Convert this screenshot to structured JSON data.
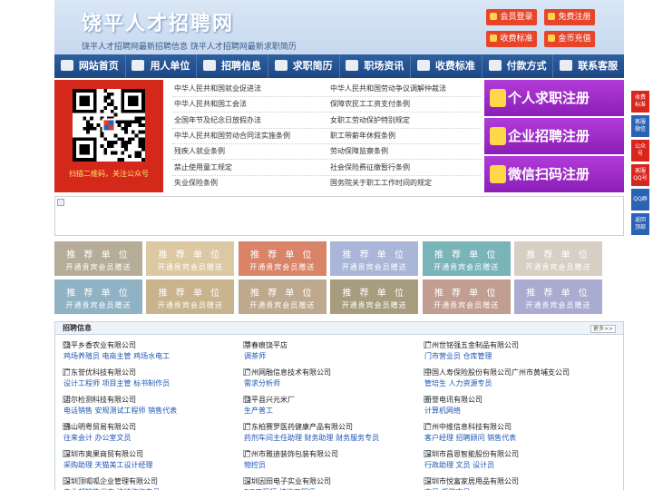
{
  "header": {
    "logo": "饶平人才招聘网",
    "slogan": "饶平人才招聘网最新招聘信息    饶平人才招聘网最新求职简历",
    "buttons": [
      {
        "label": "会员登录"
      },
      {
        "label": "免费注册"
      },
      {
        "label": "收费标准"
      },
      {
        "label": "金币充值"
      }
    ]
  },
  "nav": [
    {
      "label": "网站首页",
      "icon": "home-icon"
    },
    {
      "label": "用人单位",
      "icon": "building-icon"
    },
    {
      "label": "招聘信息",
      "icon": "chat-icon"
    },
    {
      "label": "求职简历",
      "icon": "resume-icon"
    },
    {
      "label": "职场资讯",
      "icon": "news-icon"
    },
    {
      "label": "收费标准",
      "icon": "money-icon"
    },
    {
      "label": "付款方式",
      "icon": "card-icon"
    },
    {
      "label": "联系客服",
      "icon": "phone-icon"
    }
  ],
  "qr_caption": "扫描二维码，关注公众号",
  "laws_left": [
    "中华人民共和国就业促进法",
    "中华人民共和国工会法",
    "全国年节及纪念日放假办法",
    "中华人民共和国劳动合同法实施条例",
    "残疾人就业条例",
    "禁止使用童工规定",
    "失业保险条例"
  ],
  "laws_right": [
    "中华人民共和国劳动争议调解仲裁法",
    "保障农民工工资支付条例",
    "女职工劳动保护特别规定",
    "职工带薪年休假条例",
    "劳动保障监察条例",
    "社会保险费征缴暂行条例",
    "国务院关于职工工作时间的规定"
  ],
  "register": [
    {
      "label": "个人求职注册"
    },
    {
      "label": "企业招聘注册"
    },
    {
      "label": "微信扫码注册"
    }
  ],
  "ads": {
    "line1": "推 荐 单 位",
    "line2": "开通贵宾会员赠送",
    "colors": [
      "#b5ad98",
      "#dcc9a3",
      "#d98468",
      "#a9b6d8",
      "#79b4b9",
      "#d7cfc3",
      "#8fb2c5",
      "#c9b38c",
      "#bfa98e",
      "#a79c7d",
      "#c29e91",
      "#a9acd0"
    ]
  },
  "jobs": {
    "title": "招聘信息",
    "more": "更多>>",
    "items": [
      {
        "company": "饶平乡香农业有限公司",
        "roles": "鸡场养殖员 电商主管 鸡场水电工"
      },
      {
        "company": "萃春痕饶平店",
        "roles": "调茶师"
      },
      {
        "company": "广州世铭强五金制品有限公司",
        "roles": "门市营业员 仓库管理"
      },
      {
        "company": "广东誉优科技有限公司",
        "roles": "设计工程师 项目主管 标书制作员"
      },
      {
        "company": "广州网融信息技术有限公司",
        "roles": "需求分析师"
      },
      {
        "company": "中国人寿保险股份有限公司广州市黄埔支公司",
        "roles": "管培生 人力资源专员"
      },
      {
        "company": "诺尔检测科技有限公司",
        "roles": "电话销售 安规测试工程师 销售代表"
      },
      {
        "company": "饶平县兴元米厂",
        "roles": "生产普工"
      },
      {
        "company": "新誉电讯有限公司",
        "roles": "计算机网络"
      },
      {
        "company": "佛山明粤贸易有限公司",
        "roles": "往来会计 办公室文员"
      },
      {
        "company": "广东柏赛罗医药健康产品有限公司",
        "roles": "药剂车间主任助理 财务助理 财务服务专员"
      },
      {
        "company": "广州中维信息科技有限公司",
        "roles": "客户经理 招聘顾问 销售代表"
      },
      {
        "company": "深圳市奥果商贸有限公司",
        "roles": "采购助理 天猫美工设计经理"
      },
      {
        "company": "广州市雅迪装饰包装有限公司",
        "roles": "物控员"
      },
      {
        "company": "深圳市昌恩智能股份有限公司",
        "roles": "行政助理 文员 设计员"
      },
      {
        "company": "深圳顶呱呱企业管理有限公司",
        "roles": "事业部销售代表 法律咨询专员"
      },
      {
        "company": "深圳因田电子实业有限公司",
        "roles": "PIE工程师 结构工程师"
      },
      {
        "company": "深圳市悦富家居用品有限公司",
        "roles": "文员 采购文员"
      }
    ]
  },
  "side": [
    {
      "label": "收费标准",
      "color": "#d8261d"
    },
    {
      "label": "客服微信",
      "color": "#2a63b4"
    },
    {
      "label": "公众号",
      "color": "#d8261d"
    },
    {
      "label": "客服QQ号",
      "color": "#d8261d"
    },
    {
      "label": "QQ群",
      "color": "#2a63b4"
    },
    {
      "label": "返回顶部",
      "color": "#2a63b4"
    }
  ]
}
